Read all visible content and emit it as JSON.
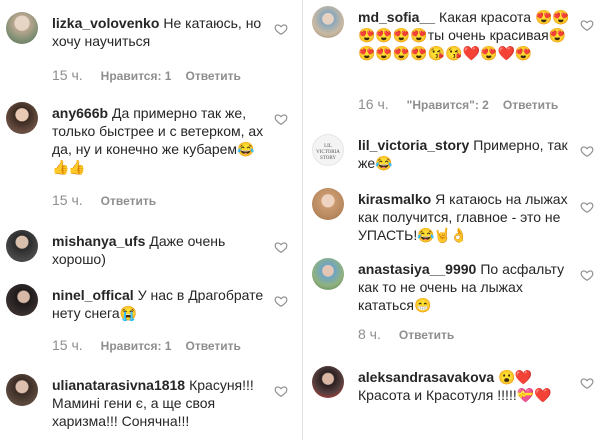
{
  "left": [
    {
      "username": "lizka_volovenko",
      "text": "Не катаюсь, но хочу научиться",
      "emoji": "",
      "time": "15 ч.",
      "likes": "Нравится: 1",
      "reply": "Ответить"
    },
    {
      "username": "any666b",
      "text": "Да примерно так же, только быстрее и с ветерком, ах да, ну и конечно же кубарем",
      "emoji": "😂👍👍",
      "time": "15 ч.",
      "likes": "",
      "reply": "Ответить"
    },
    {
      "username": "mishanya_ufs",
      "text": "Даже очень хорошо)",
      "emoji": "",
      "time": "",
      "likes": "",
      "reply": ""
    },
    {
      "username": "ninel_offical",
      "text": "У нас в Драгобрате нету снега",
      "emoji": "😭",
      "time": "15 ч.",
      "likes": "Нравится: 1",
      "reply": "Ответить"
    },
    {
      "username": "ulianatarasivna1818",
      "text": "Красуня!!! Мамині гени є, а ще своя харизма!!! Сонячна!!!",
      "emoji": "",
      "time": "",
      "likes": "",
      "reply": ""
    }
  ],
  "right": [
    {
      "username": "md_sofia__",
      "text": "Какая красота 😍😍😍😍😍😍ты очень красивая😍😍😍😍😍😘😘❤️😍❤️😍",
      "emoji": "",
      "time": "16 ч.",
      "likes": "\"Нравится\": 2",
      "reply": "Ответить"
    },
    {
      "username": "lil_victoria_story",
      "text": "Примерно, так же",
      "emoji": "😂",
      "time": "",
      "likes": "",
      "reply": ""
    },
    {
      "username": "kirasmalko",
      "text": "Я катаюсь на лыжах как получится, главное - это не УПАСТЬ!",
      "emoji": "😂🤘👌",
      "time": "",
      "likes": "",
      "reply": ""
    },
    {
      "username": "anastasiya__9990",
      "text": "По асфальту как то не очень на лыжах кататься",
      "emoji": "😁",
      "time": "8 ч.",
      "likes": "",
      "reply": "Ответить"
    },
    {
      "username": "aleksandrasavakova",
      "text": "",
      "emoji": "😮❤️",
      "line2": "Красота и Красотуля !!!!!💝❤️",
      "time": "",
      "likes": "",
      "reply": ""
    }
  ],
  "avatar_label": "LIL VICTORIA STORY",
  "colors": {
    "text": "#262626",
    "muted": "#8e8e8e",
    "heart": "#8e8e8e"
  }
}
